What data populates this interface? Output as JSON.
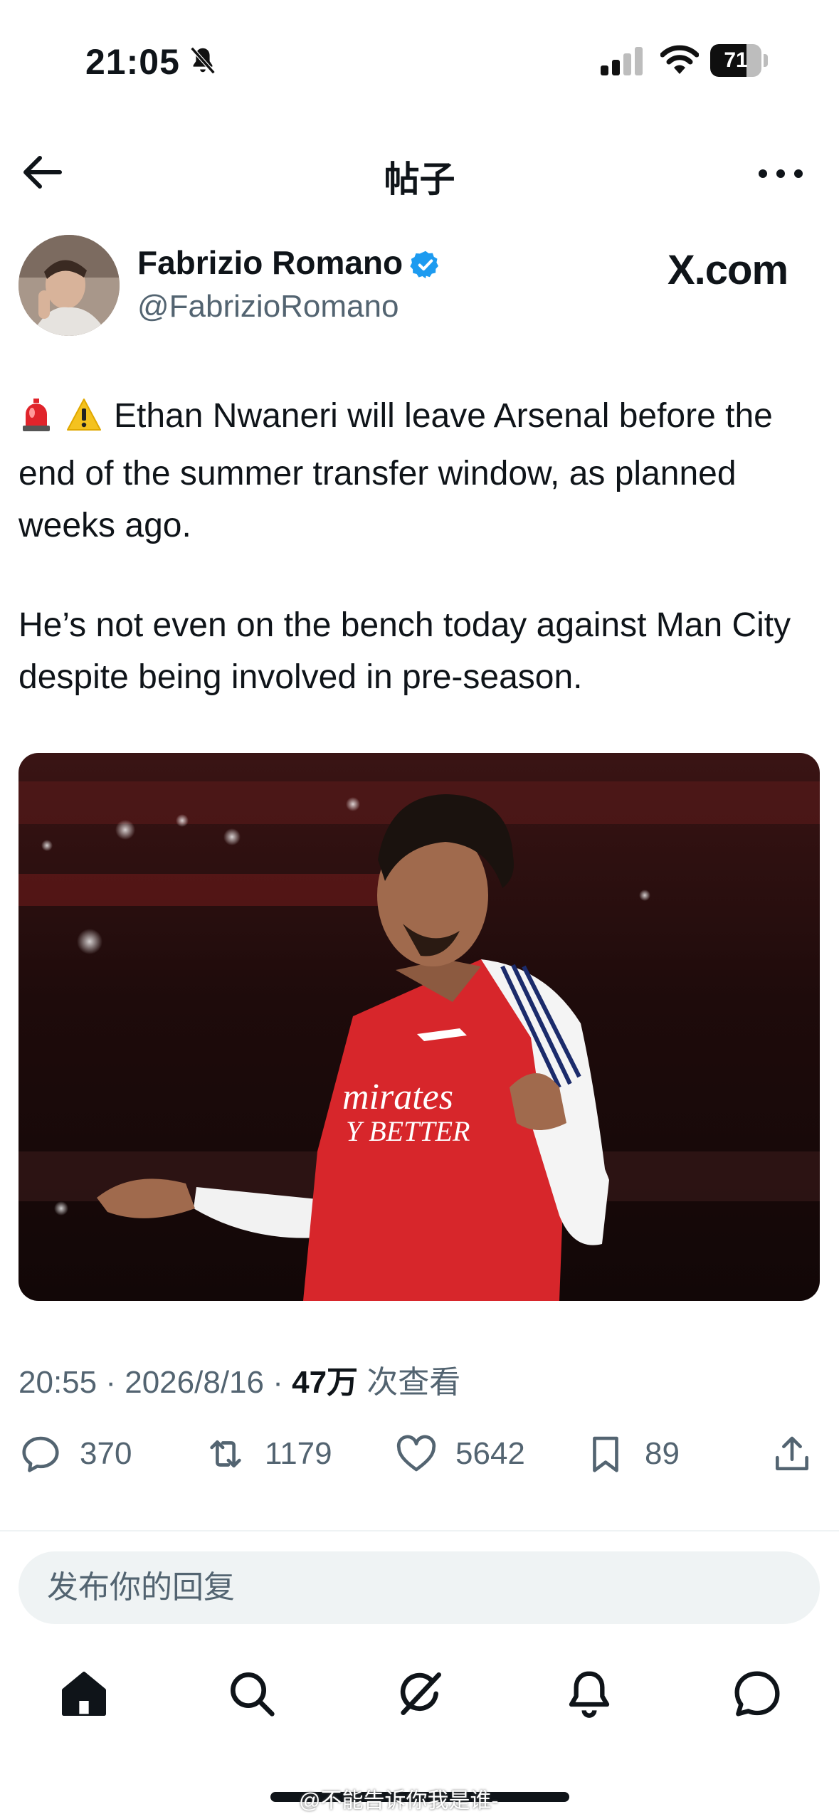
{
  "status_bar": {
    "time": "21:05",
    "battery_percent": "71",
    "battery_level": 0.71,
    "icons": [
      "bell-off-icon",
      "cellular-signal-icon",
      "wifi-icon",
      "battery-icon"
    ]
  },
  "header": {
    "title": "帖子",
    "back_icon": "arrow-left-icon",
    "more_icon": "more-horizontal-icon"
  },
  "post": {
    "author": {
      "name": "Fabrizio Romano",
      "handle": "@FabrizioRomano",
      "verified": true
    },
    "source_watermark": "X.com",
    "paragraphs": [
      "Ethan Nwaneri will leave Arsenal before the end of the summer transfer window, as planned weeks ago.",
      "He’s not even on the bench today against Man City despite being involved in pre-season."
    ],
    "leading_emojis": [
      "rotating-light-emoji",
      "warning-emoji"
    ],
    "jersey_text": [
      "mirates",
      "Y BETTER"
    ],
    "meta": {
      "time": "20:55",
      "date": "2026/8/16",
      "views": "47万",
      "views_label": "次查看",
      "separator": "·"
    },
    "actions": {
      "replies": "370",
      "retweets": "1179",
      "likes": "5642",
      "bookmarks": "89"
    }
  },
  "reply": {
    "placeholder": "发布你的回复"
  },
  "tabs": [
    "home-icon",
    "search-icon",
    "grok-icon",
    "notifications-icon",
    "messages-icon"
  ],
  "watermark": "@不能告诉你我是谁-",
  "colors": {
    "text": "#0f1419",
    "secondary": "#536471",
    "verified": "#1d9bf0",
    "reply_bg": "#eff3f4"
  }
}
